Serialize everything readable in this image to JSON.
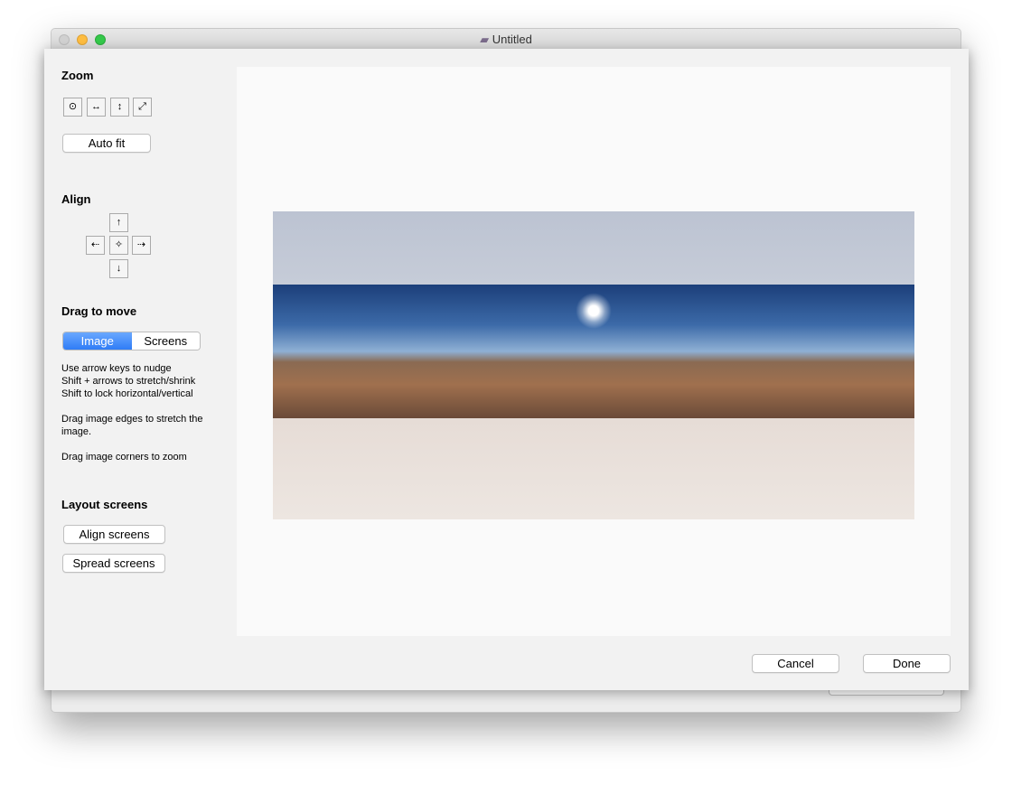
{
  "window": {
    "title": "Untitled"
  },
  "sidebar": {
    "zoom": {
      "heading": "Zoom",
      "icons": [
        "zoom-center-icon",
        "zoom-horizontal-icon",
        "zoom-vertical-icon",
        "zoom-diagonal-icon"
      ],
      "glyphs": [
        "⊙",
        "↔",
        "↕",
        "⤢"
      ],
      "autofit_label": "Auto fit"
    },
    "align": {
      "heading": "Align",
      "glyphs": {
        "up": "↑",
        "left": "⇠",
        "center": "✧",
        "right": "⇢",
        "down": "↓"
      }
    },
    "drag": {
      "heading": "Drag to move",
      "segments": [
        "Image",
        "Screens"
      ],
      "selected": "Image",
      "help1": "Use arrow keys to nudge",
      "help2": "Shift + arrows to stretch/shrink",
      "help3": "Shift to lock horizontal/vertical",
      "help4": "Drag image edges to stretch the image.",
      "help5": "Drag image corners to zoom"
    },
    "layout": {
      "heading": "Layout screens",
      "align_label": "Align screens",
      "spread_label": "Spread screens"
    }
  },
  "footer": {
    "cancel_label": "Cancel",
    "done_label": "Done"
  },
  "colors": {
    "accent": "#2f7cf6"
  }
}
